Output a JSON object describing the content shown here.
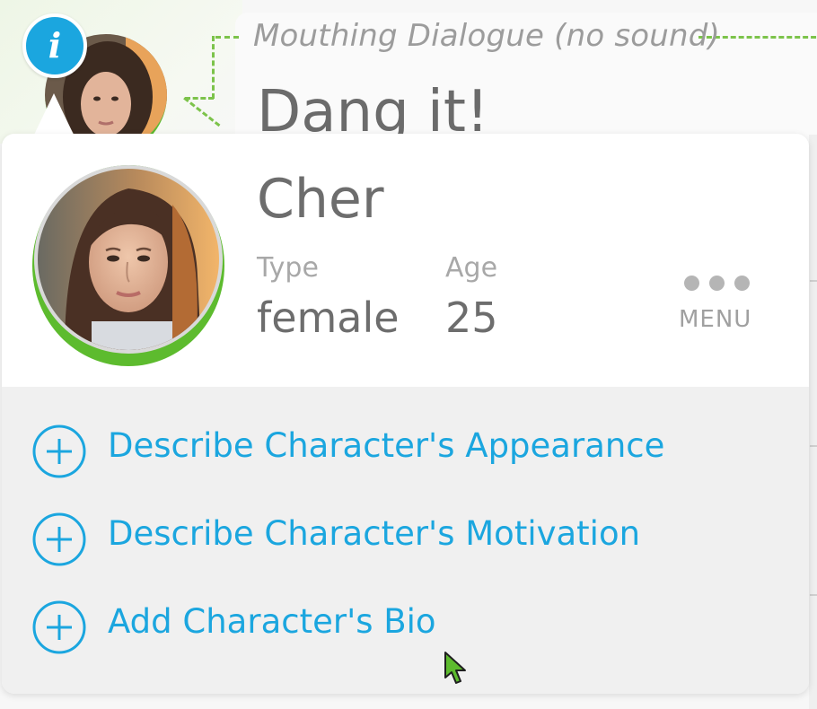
{
  "scene": {
    "dialogue_label": "Mouthing Dialogue (no sound)",
    "dialogue_text": "Dang it!",
    "info_badge": "i"
  },
  "character": {
    "name": "Cher",
    "type_label": "Type",
    "type_value": "female",
    "age_label": "Age",
    "age_value": "25"
  },
  "menu": {
    "icon": "more-dots-icon",
    "label": "MENU"
  },
  "actions": [
    {
      "icon": "plus-circle-icon",
      "label": "Describe Character's Appearance"
    },
    {
      "icon": "plus-circle-icon",
      "label": "Describe Character's Motivation"
    },
    {
      "icon": "plus-circle-icon",
      "label": "Add Character's Bio"
    }
  ],
  "colors": {
    "accent_blue": "#1ba6df",
    "accent_green": "#5dbb2e",
    "text_dark": "#6d6d6d",
    "text_muted": "#a8a8a8",
    "actions_bg": "#f0f0f0"
  }
}
